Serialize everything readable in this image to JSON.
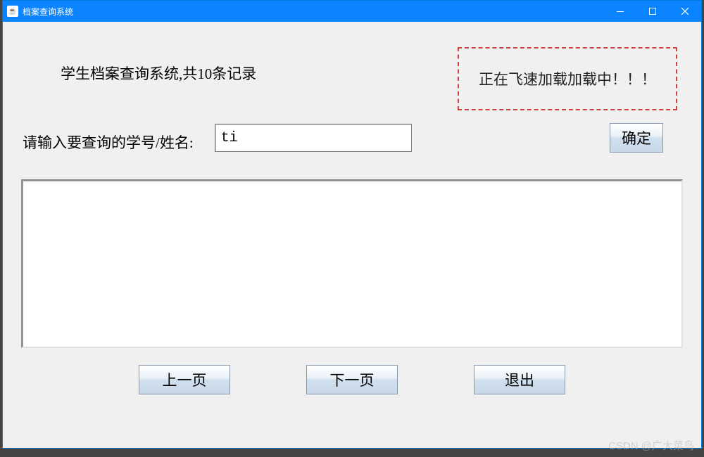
{
  "window": {
    "title": "档案查询系统"
  },
  "header": {
    "title": "学生档案查询系统,共10条记录",
    "loading_text": "正在飞速加载加载中！！！"
  },
  "search": {
    "label": "请输入要查询的学号/姓名:",
    "input_value": "ti",
    "confirm_label": "确定"
  },
  "footer": {
    "prev_label": "上一页",
    "next_label": "下一页",
    "exit_label": "退出"
  },
  "watermark": "CSDN @广大菜鸟"
}
